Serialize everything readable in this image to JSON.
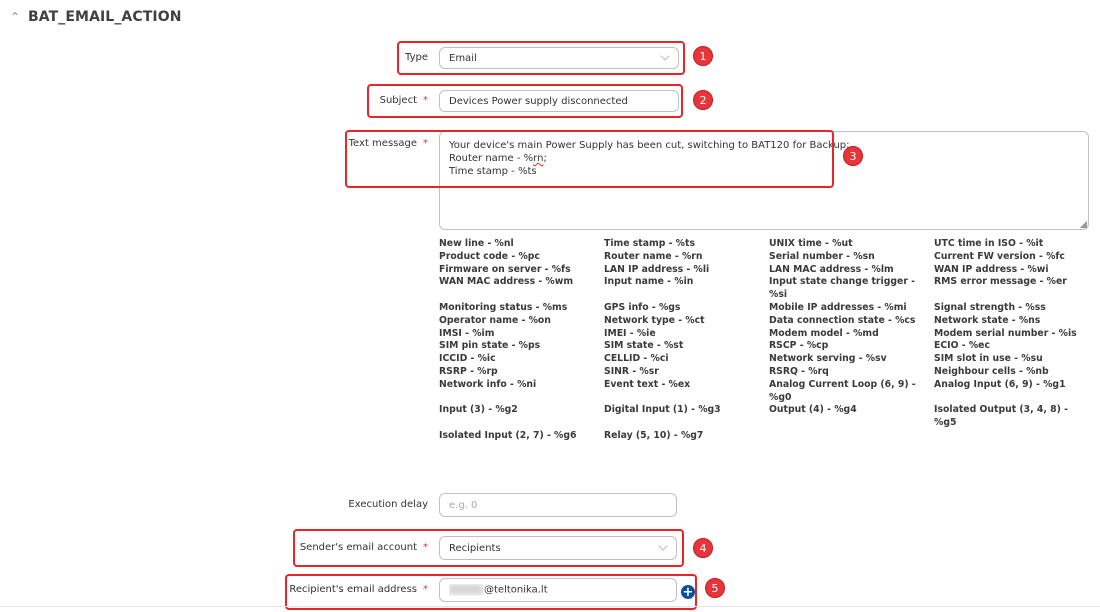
{
  "section": {
    "title": "BAT_EMAIL_ACTION",
    "collapse_icon": "chevron-up-icon"
  },
  "form": {
    "type": {
      "label": "Type",
      "value": "Email"
    },
    "subject": {
      "label": "Subject",
      "required": "*",
      "value": "Devices Power supply disconnected"
    },
    "text_message": {
      "label": "Text message",
      "required": "*",
      "lines": [
        "Your device's main Power Supply has been cut, switching to BAT120 for Backup;",
        "Router name - %",
        "rn",
        ";",
        "Time stamp - %ts"
      ]
    },
    "execution_delay": {
      "label": "Execution delay",
      "placeholder": "e.g. 0"
    },
    "sender_account": {
      "label": "Sender's email account",
      "required": "*",
      "value": "Recipients"
    },
    "recipient_address": {
      "label": "Recipient's email address",
      "required": "*",
      "value": "@teltonika.lt",
      "add_icon": "plus-circle-icon"
    }
  },
  "variables": [
    "New line - %nl",
    "Time stamp - %ts",
    "UNIX time - %ut",
    "UTC time in ISO - %it",
    "Product code - %pc",
    "Router name - %rn",
    "Serial number - %sn",
    "Current FW version - %fc",
    "Firmware on server - %fs",
    "LAN IP address - %li",
    "LAN MAC address - %lm",
    "WAN IP address - %wi",
    "WAN MAC address - %wm",
    "Input name - %in",
    "Input state change trigger - %si",
    "RMS error message - %er",
    "Monitoring status - %ms",
    "GPS info - %gs",
    "Mobile IP addresses - %mi",
    "Signal strength - %ss",
    "Operator name - %on",
    "Network type - %ct",
    "Data connection state - %cs",
    "Network state - %ns",
    "IMSI - %im",
    "IMEI - %ie",
    "Modem model - %md",
    "Modem serial number - %is",
    "SIM pin state - %ps",
    "SIM state - %st",
    "RSCP - %cp",
    "ECIO - %ec",
    "ICCID - %ic",
    "CELLID - %ci",
    "Network serving - %sv",
    "SIM slot in use - %su",
    "RSRP - %rp",
    "SINR - %sr",
    "RSRQ - %rq",
    "Neighbour cells - %nb",
    "Network info - %ni",
    "Event text - %ex",
    "Analog Current Loop (6, 9) - %g0",
    "Analog Input (6, 9) - %g1",
    "Input (3) - %g2",
    "Digital Input (1) - %g3",
    "Output (4) - %g4",
    "Isolated Output (3, 4, 8) - %g5",
    "Isolated Input (2, 7) - %g6",
    "Relay (5, 10) - %g7",
    "",
    ""
  ],
  "annotations": [
    "1",
    "2",
    "3",
    "4",
    "5"
  ],
  "colors": {
    "highlight": "#e8252b",
    "badge": "#e8353a",
    "required": "#e0312f",
    "add_button": "#0a4f9c"
  }
}
